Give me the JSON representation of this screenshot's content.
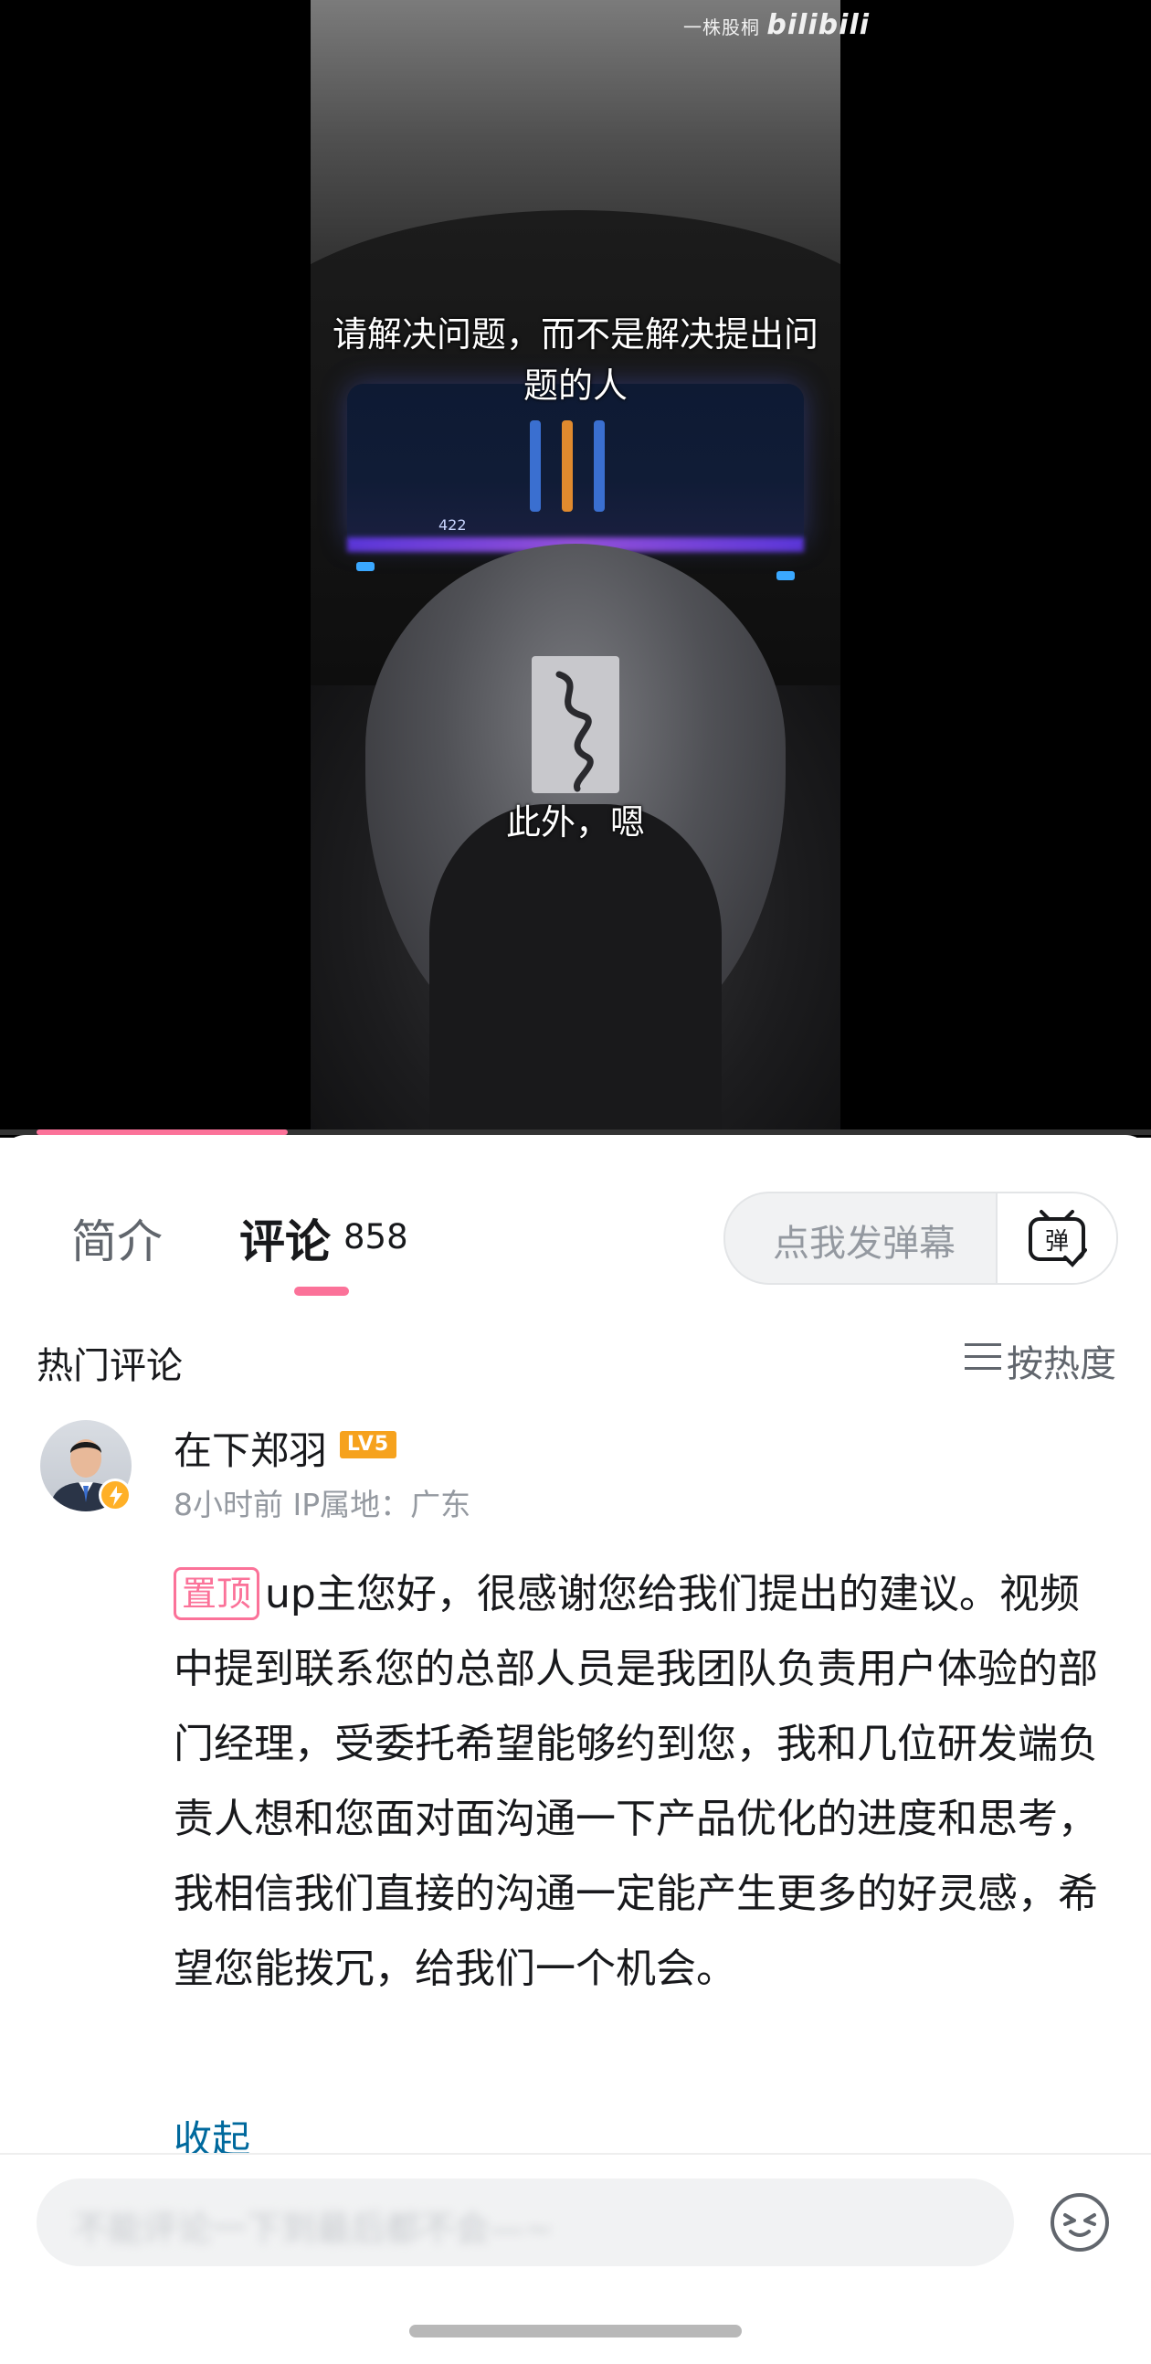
{
  "video": {
    "watermark_prefix": "一株股桐",
    "watermark_brand": "bilibili",
    "subtitle_top": "请解决问题，而不是解决提出问题的人",
    "subtitle_bottom": "此外，嗯",
    "dash_speed": "422",
    "progress_fraction": 0.25
  },
  "tabs": {
    "intro_label": "简介",
    "comments_label": "评论",
    "comments_count": "858"
  },
  "danmaku": {
    "placeholder": "点我发弹幕",
    "button_icon": "danmaku-toggle-icon",
    "button_glyph": "弹"
  },
  "comments_header": {
    "title": "热门评论",
    "sort_label": "按热度",
    "sort_icon": "menu-lines-icon"
  },
  "comment": {
    "username": "在下郑羽",
    "level": "LV5",
    "meta": "8小时前 IP属地：广东",
    "pinned_label": "置顶",
    "text": "up主您好，很感谢您给我们提出的建议。视频中提到联系您的总部人员是我团队负责用户体验的部门经理，受委托希望能够约到您，我和几位研发端负责人想和您面对面沟通一下产品优化的进度和思考，我相信我们直接的沟通一定能产生更多的好灵感，希望您能拨冗，给我们一个机会。",
    "collapse_label": "收起",
    "avatar_icon": "avatar-icon",
    "badge_icon": "lightning-badge-icon"
  },
  "reply_bar": {
    "placeholder": "不能评论一下到最后都不会—~",
    "emoji_icon": "emoji-icon"
  },
  "colors": {
    "accent_pink": "#fb7299",
    "link_blue": "#00699d",
    "level_orange": "#f6a21d"
  }
}
